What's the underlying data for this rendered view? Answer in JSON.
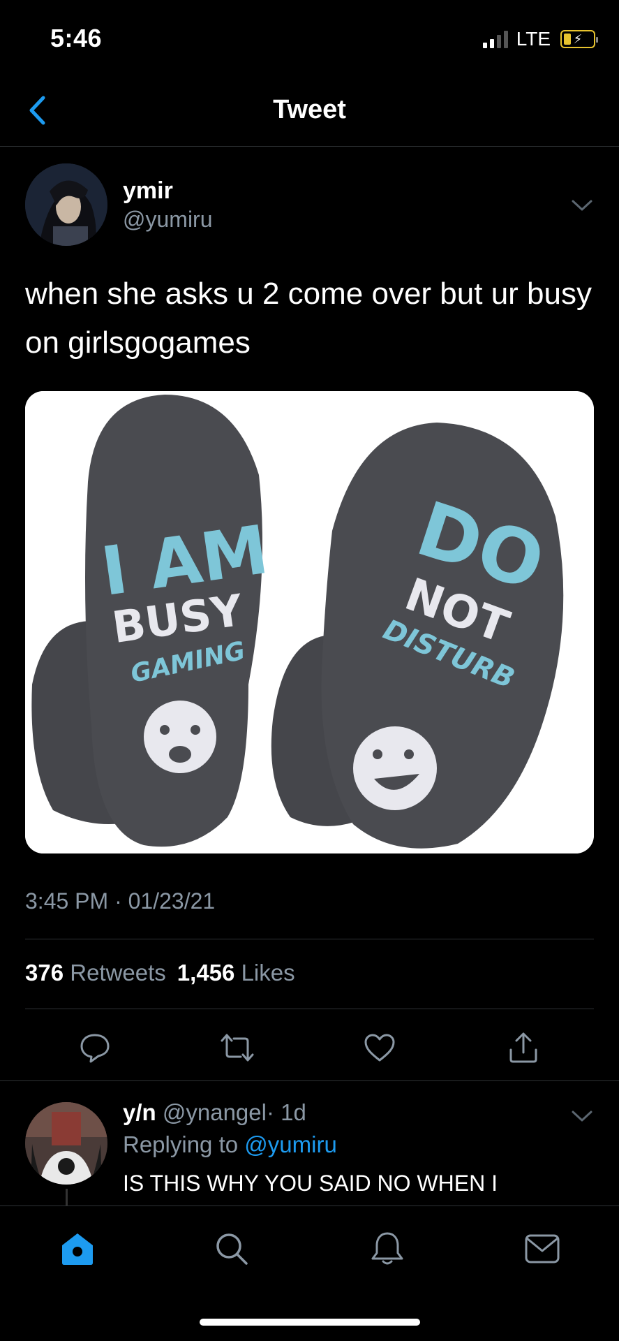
{
  "status_bar": {
    "time": "5:46",
    "network": "LTE"
  },
  "nav": {
    "title": "Tweet"
  },
  "tweet": {
    "author_name": "ymir",
    "author_handle": "@yumiru",
    "text": "when she asks u 2 come over but ur busy on girlsgogames",
    "image_text": {
      "left_sock": [
        "I AM",
        "BUSY",
        "GAMING"
      ],
      "right_sock": [
        "DO",
        "NOT",
        "DISTURB"
      ]
    },
    "timestamp": "3:45 PM · 01/23/21",
    "retweets_count": "376",
    "retweets_label": "Retweets",
    "likes_count": "1,456",
    "likes_label": "Likes"
  },
  "actions": [
    "reply-icon",
    "retweet-icon",
    "like-icon",
    "share-icon"
  ],
  "reply": {
    "name": "y/n",
    "handle": "@ynangel",
    "time": "· 1d",
    "replying_prefix": "Replying to",
    "replying_to": "@yumiru",
    "text": "IS THIS WHY YOU SAID NO WHEN I"
  },
  "tab_bar": [
    "home-icon",
    "search-icon",
    "notifications-icon",
    "messages-icon"
  ],
  "colors": {
    "background": "#000000",
    "accent": "#1d9bf0",
    "secondary_text": "#8b98a5",
    "divider": "#2f3336",
    "battery": "#e7c32e"
  }
}
